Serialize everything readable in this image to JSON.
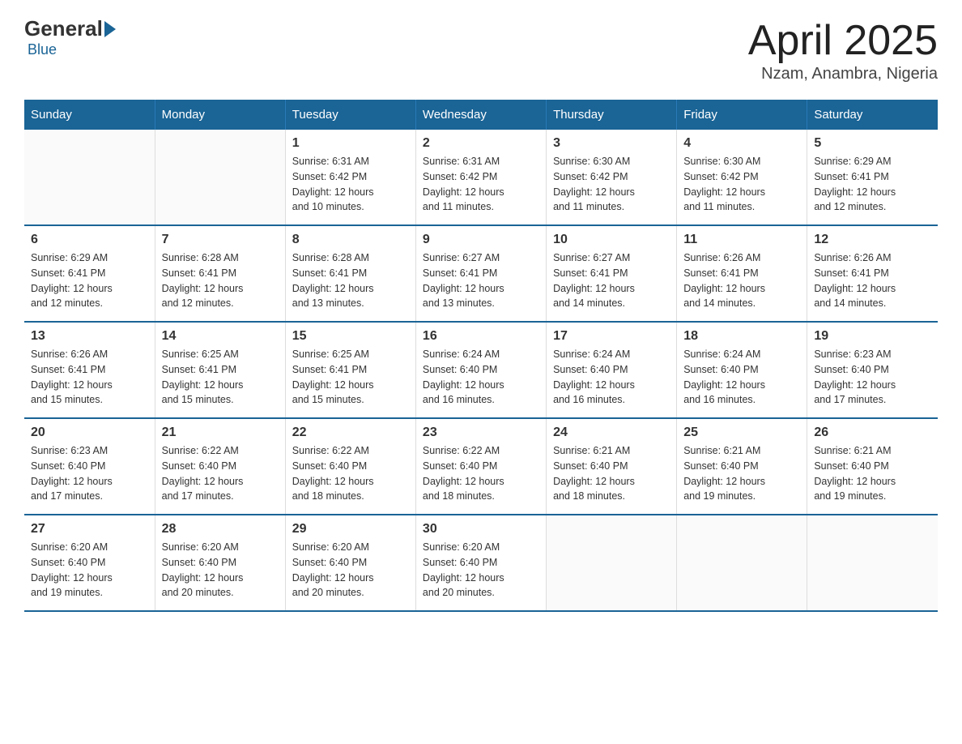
{
  "logo": {
    "general": "General",
    "blue": "Blue"
  },
  "title": "April 2025",
  "subtitle": "Nzam, Anambra, Nigeria",
  "headers": [
    "Sunday",
    "Monday",
    "Tuesday",
    "Wednesday",
    "Thursday",
    "Friday",
    "Saturday"
  ],
  "weeks": [
    [
      {
        "day": "",
        "detail": ""
      },
      {
        "day": "",
        "detail": ""
      },
      {
        "day": "1",
        "detail": "Sunrise: 6:31 AM\nSunset: 6:42 PM\nDaylight: 12 hours\nand 10 minutes."
      },
      {
        "day": "2",
        "detail": "Sunrise: 6:31 AM\nSunset: 6:42 PM\nDaylight: 12 hours\nand 11 minutes."
      },
      {
        "day": "3",
        "detail": "Sunrise: 6:30 AM\nSunset: 6:42 PM\nDaylight: 12 hours\nand 11 minutes."
      },
      {
        "day": "4",
        "detail": "Sunrise: 6:30 AM\nSunset: 6:42 PM\nDaylight: 12 hours\nand 11 minutes."
      },
      {
        "day": "5",
        "detail": "Sunrise: 6:29 AM\nSunset: 6:41 PM\nDaylight: 12 hours\nand 12 minutes."
      }
    ],
    [
      {
        "day": "6",
        "detail": "Sunrise: 6:29 AM\nSunset: 6:41 PM\nDaylight: 12 hours\nand 12 minutes."
      },
      {
        "day": "7",
        "detail": "Sunrise: 6:28 AM\nSunset: 6:41 PM\nDaylight: 12 hours\nand 12 minutes."
      },
      {
        "day": "8",
        "detail": "Sunrise: 6:28 AM\nSunset: 6:41 PM\nDaylight: 12 hours\nand 13 minutes."
      },
      {
        "day": "9",
        "detail": "Sunrise: 6:27 AM\nSunset: 6:41 PM\nDaylight: 12 hours\nand 13 minutes."
      },
      {
        "day": "10",
        "detail": "Sunrise: 6:27 AM\nSunset: 6:41 PM\nDaylight: 12 hours\nand 14 minutes."
      },
      {
        "day": "11",
        "detail": "Sunrise: 6:26 AM\nSunset: 6:41 PM\nDaylight: 12 hours\nand 14 minutes."
      },
      {
        "day": "12",
        "detail": "Sunrise: 6:26 AM\nSunset: 6:41 PM\nDaylight: 12 hours\nand 14 minutes."
      }
    ],
    [
      {
        "day": "13",
        "detail": "Sunrise: 6:26 AM\nSunset: 6:41 PM\nDaylight: 12 hours\nand 15 minutes."
      },
      {
        "day": "14",
        "detail": "Sunrise: 6:25 AM\nSunset: 6:41 PM\nDaylight: 12 hours\nand 15 minutes."
      },
      {
        "day": "15",
        "detail": "Sunrise: 6:25 AM\nSunset: 6:41 PM\nDaylight: 12 hours\nand 15 minutes."
      },
      {
        "day": "16",
        "detail": "Sunrise: 6:24 AM\nSunset: 6:40 PM\nDaylight: 12 hours\nand 16 minutes."
      },
      {
        "day": "17",
        "detail": "Sunrise: 6:24 AM\nSunset: 6:40 PM\nDaylight: 12 hours\nand 16 minutes."
      },
      {
        "day": "18",
        "detail": "Sunrise: 6:24 AM\nSunset: 6:40 PM\nDaylight: 12 hours\nand 16 minutes."
      },
      {
        "day": "19",
        "detail": "Sunrise: 6:23 AM\nSunset: 6:40 PM\nDaylight: 12 hours\nand 17 minutes."
      }
    ],
    [
      {
        "day": "20",
        "detail": "Sunrise: 6:23 AM\nSunset: 6:40 PM\nDaylight: 12 hours\nand 17 minutes."
      },
      {
        "day": "21",
        "detail": "Sunrise: 6:22 AM\nSunset: 6:40 PM\nDaylight: 12 hours\nand 17 minutes."
      },
      {
        "day": "22",
        "detail": "Sunrise: 6:22 AM\nSunset: 6:40 PM\nDaylight: 12 hours\nand 18 minutes."
      },
      {
        "day": "23",
        "detail": "Sunrise: 6:22 AM\nSunset: 6:40 PM\nDaylight: 12 hours\nand 18 minutes."
      },
      {
        "day": "24",
        "detail": "Sunrise: 6:21 AM\nSunset: 6:40 PM\nDaylight: 12 hours\nand 18 minutes."
      },
      {
        "day": "25",
        "detail": "Sunrise: 6:21 AM\nSunset: 6:40 PM\nDaylight: 12 hours\nand 19 minutes."
      },
      {
        "day": "26",
        "detail": "Sunrise: 6:21 AM\nSunset: 6:40 PM\nDaylight: 12 hours\nand 19 minutes."
      }
    ],
    [
      {
        "day": "27",
        "detail": "Sunrise: 6:20 AM\nSunset: 6:40 PM\nDaylight: 12 hours\nand 19 minutes."
      },
      {
        "day": "28",
        "detail": "Sunrise: 6:20 AM\nSunset: 6:40 PM\nDaylight: 12 hours\nand 20 minutes."
      },
      {
        "day": "29",
        "detail": "Sunrise: 6:20 AM\nSunset: 6:40 PM\nDaylight: 12 hours\nand 20 minutes."
      },
      {
        "day": "30",
        "detail": "Sunrise: 6:20 AM\nSunset: 6:40 PM\nDaylight: 12 hours\nand 20 minutes."
      },
      {
        "day": "",
        "detail": ""
      },
      {
        "day": "",
        "detail": ""
      },
      {
        "day": "",
        "detail": ""
      }
    ]
  ]
}
